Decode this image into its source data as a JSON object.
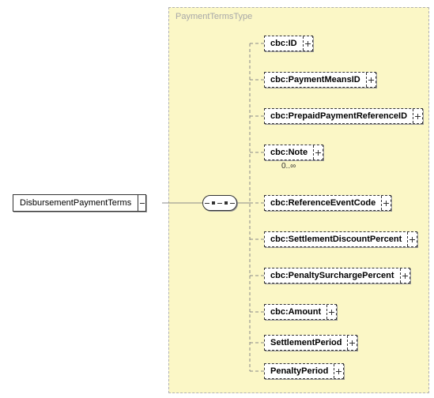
{
  "type_name": "PaymentTermsType",
  "root": {
    "label": "DisbursementPaymentTerms"
  },
  "children": [
    {
      "label": "cbc:ID",
      "optional": true,
      "cardinality": ""
    },
    {
      "label": "cbc:PaymentMeansID",
      "optional": true,
      "cardinality": ""
    },
    {
      "label": "cbc:PrepaidPaymentReferenceID",
      "optional": true,
      "cardinality": ""
    },
    {
      "label": "cbc:Note",
      "optional": true,
      "cardinality": "0..∞"
    },
    {
      "label": "cbc:ReferenceEventCode",
      "optional": true,
      "cardinality": ""
    },
    {
      "label": "cbc:SettlementDiscountPercent",
      "optional": true,
      "cardinality": ""
    },
    {
      "label": "cbc:PenaltySurchargePercent",
      "optional": true,
      "cardinality": ""
    },
    {
      "label": "cbc:Amount",
      "optional": true,
      "cardinality": ""
    },
    {
      "label": "SettlementPeriod",
      "optional": true,
      "cardinality": ""
    },
    {
      "label": "PenaltyPeriod",
      "optional": true,
      "cardinality": ""
    }
  ]
}
